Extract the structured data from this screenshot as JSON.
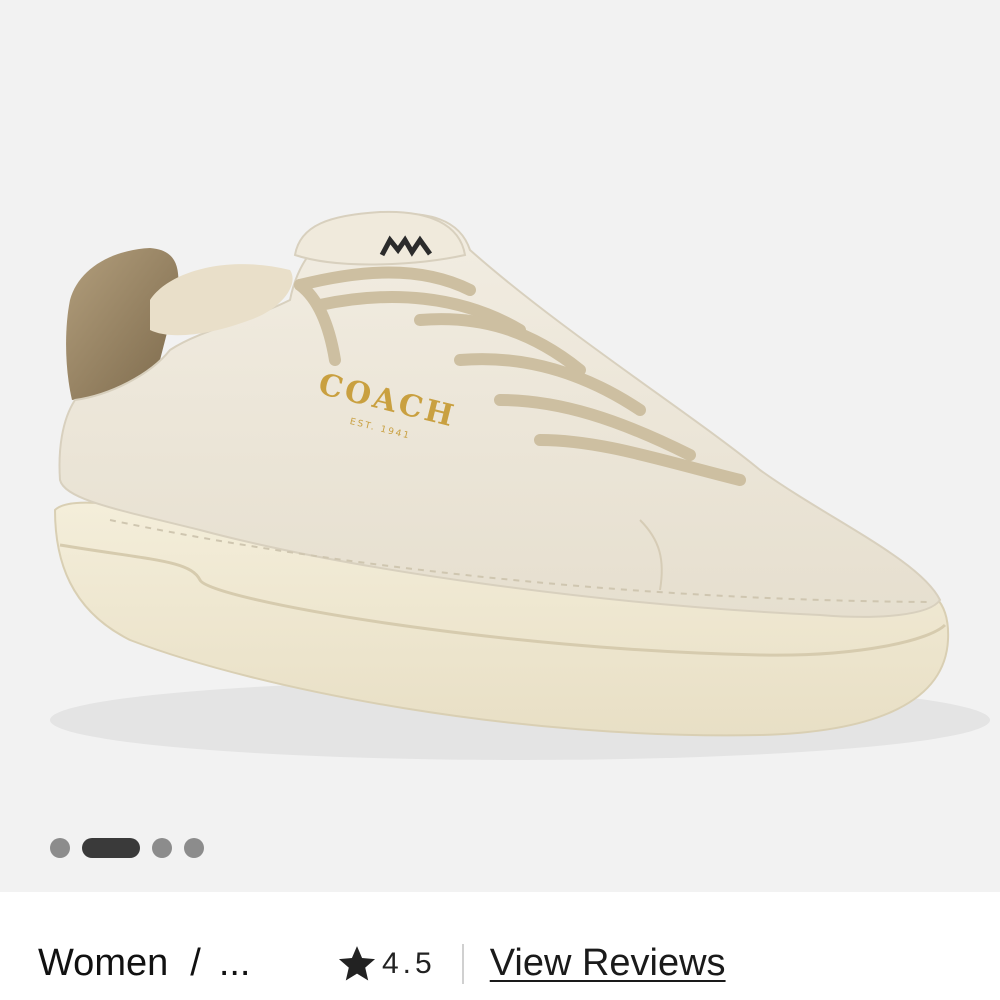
{
  "product": {
    "image_alt": "Coach white leather sneaker",
    "logo_text": "COACH",
    "logo_subtext": "EST. 1941"
  },
  "gallery": {
    "dot_count": 4,
    "active_index": 1
  },
  "breadcrumb": {
    "category": "Women",
    "separator": "/",
    "more": "..."
  },
  "rating": {
    "icon": "star-icon",
    "value": "4.5",
    "reviews_label": "View Reviews"
  },
  "colors": {
    "gallery_bg": "#f2f2f2",
    "active_dot": "#3a3a3a",
    "inactive_dot": "#8c8c8c",
    "shoe_leather": "#ece6d8",
    "heel_tab": "#9c8a6c",
    "logo_gold": "#c9a040"
  }
}
